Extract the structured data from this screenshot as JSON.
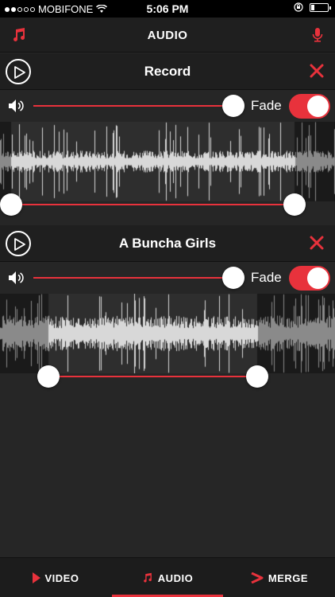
{
  "status_bar": {
    "carrier": "MOBIFONE",
    "time": "5:06 PM",
    "signal_bars": 2,
    "battery_level": 0.15
  },
  "nav": {
    "title": "AUDIO",
    "left_icon": "music-note-icon",
    "right_icon": "microphone-icon"
  },
  "tracks": [
    {
      "title": "Record",
      "fade_label": "Fade",
      "fade_on": true,
      "volume": 1.0,
      "trim_start": 0.0,
      "trim_end": 0.85
    },
    {
      "title": "A Buncha Girls",
      "fade_label": "Fade",
      "fade_on": true,
      "volume": 1.0,
      "trim_start": 0.13,
      "trim_end": 0.77
    }
  ],
  "tabs": [
    {
      "label": "VIDEO",
      "icon": "play-triangle-icon",
      "active": false
    },
    {
      "label": "AUDIO",
      "icon": "music-note-icon",
      "active": true
    },
    {
      "label": "MERGE",
      "icon": "merge-arrow-icon",
      "active": false
    }
  ],
  "colors": {
    "accent": "#e8323c",
    "background": "#262626",
    "panel": "#1f1f1f"
  }
}
